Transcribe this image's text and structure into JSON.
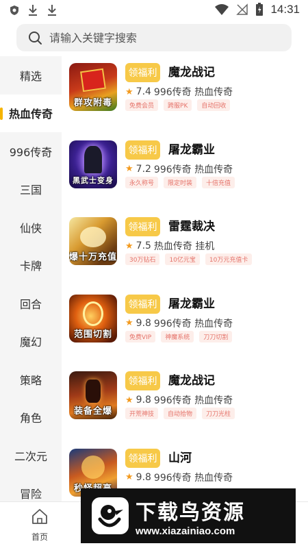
{
  "status_bar": {
    "time": "14:31"
  },
  "search": {
    "placeholder": "请输入关键字搜索"
  },
  "sidebar": {
    "items": [
      {
        "label": "精选"
      },
      {
        "label": "热血传奇"
      },
      {
        "label": "996传奇"
      },
      {
        "label": "三国"
      },
      {
        "label": "仙侠"
      },
      {
        "label": "卡牌"
      },
      {
        "label": "回合"
      },
      {
        "label": "魔幻"
      },
      {
        "label": "策略"
      },
      {
        "label": "角色"
      },
      {
        "label": "二次元"
      },
      {
        "label": "冒险"
      }
    ],
    "active_index": 1
  },
  "games": [
    {
      "title": "魔龙战记",
      "button": "领福利",
      "rating": "7.4",
      "tags_text": "996传奇 热血传奇",
      "tags": [
        "免费会员",
        "跨服PK",
        "自动回收"
      ],
      "thumb_caption": "群攻附毒"
    },
    {
      "title": "屠龙霸业",
      "button": "领福利",
      "rating": "7.2",
      "tags_text": "996传奇 热血传奇",
      "tags": [
        "永久称号",
        "限定时装",
        "十倍充值"
      ],
      "thumb_caption": "黑武士变身"
    },
    {
      "title": "雷霆裁决",
      "button": "领福利",
      "rating": "7.5",
      "tags_text": "热血传奇 挂机",
      "tags": [
        "30万钻石",
        "10亿元宝",
        "10万元充值卡"
      ],
      "thumb_caption": "爆十万充值"
    },
    {
      "title": "屠龙霸业",
      "button": "领福利",
      "rating": "9.8",
      "tags_text": "996传奇 热血传奇",
      "tags": [
        "免费VIP",
        "神魔系统",
        "刀刀切割"
      ],
      "thumb_caption": "范围切割"
    },
    {
      "title": "魔龙战记",
      "button": "领福利",
      "rating": "9.8",
      "tags_text": "996传奇 热血传奇",
      "tags": [
        "开荒神技",
        "自动拾物",
        "刀刀光柱"
      ],
      "thumb_caption": "装备全爆"
    },
    {
      "title": "山河",
      "button": "领福利",
      "rating": "9.8",
      "tags_text": "996传奇 热血传奇",
      "tags": [],
      "thumb_caption": "秒怪超高"
    }
  ],
  "bottom_nav": {
    "home_label": "首页"
  },
  "watermark": {
    "title": "下载鸟资源",
    "url": "www.xiazainiao.com"
  },
  "colors": {
    "accent": "#f7c948",
    "active_bar": "#f5b400",
    "tag_text": "#e5736a",
    "tag_bg": "#fdeeea",
    "star": "#f39a1e"
  }
}
